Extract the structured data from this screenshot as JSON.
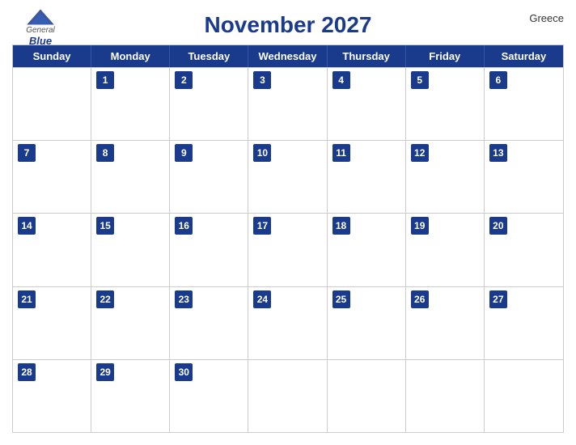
{
  "header": {
    "title": "November 2027",
    "country": "Greece",
    "logo": {
      "general": "General",
      "blue": "Blue"
    }
  },
  "calendar": {
    "days_of_week": [
      "Sunday",
      "Monday",
      "Tuesday",
      "Wednesday",
      "Thursday",
      "Friday",
      "Saturday"
    ],
    "weeks": [
      [
        {
          "day": "",
          "empty": true
        },
        {
          "day": "1"
        },
        {
          "day": "2"
        },
        {
          "day": "3"
        },
        {
          "day": "4"
        },
        {
          "day": "5"
        },
        {
          "day": "6"
        }
      ],
      [
        {
          "day": "7"
        },
        {
          "day": "8"
        },
        {
          "day": "9"
        },
        {
          "day": "10"
        },
        {
          "day": "11"
        },
        {
          "day": "12"
        },
        {
          "day": "13"
        }
      ],
      [
        {
          "day": "14"
        },
        {
          "day": "15"
        },
        {
          "day": "16"
        },
        {
          "day": "17"
        },
        {
          "day": "18"
        },
        {
          "day": "19"
        },
        {
          "day": "20"
        }
      ],
      [
        {
          "day": "21"
        },
        {
          "day": "22"
        },
        {
          "day": "23"
        },
        {
          "day": "24"
        },
        {
          "day": "25"
        },
        {
          "day": "26"
        },
        {
          "day": "27"
        }
      ],
      [
        {
          "day": "28"
        },
        {
          "day": "29"
        },
        {
          "day": "30"
        },
        {
          "day": "",
          "empty": true
        },
        {
          "day": "",
          "empty": true
        },
        {
          "day": "",
          "empty": true
        },
        {
          "day": "",
          "empty": true
        }
      ]
    ]
  },
  "colors": {
    "header_bg": "#1a3a8c",
    "header_text": "#ffffff",
    "border": "#cccccc"
  }
}
